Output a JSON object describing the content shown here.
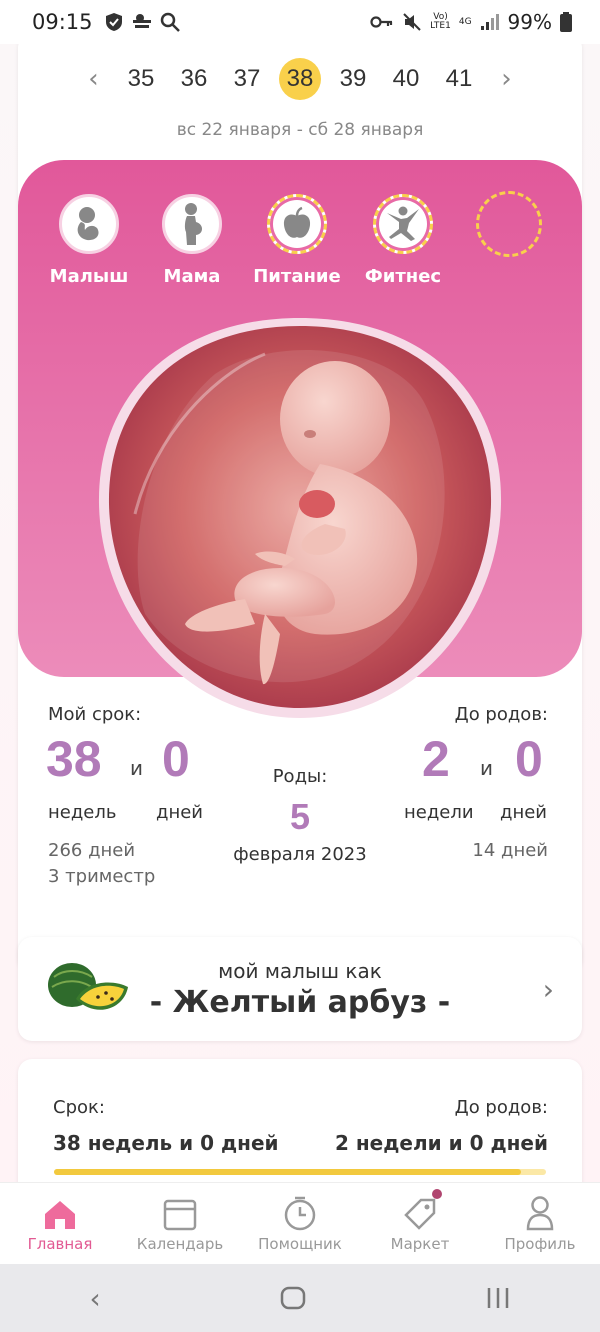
{
  "status_bar": {
    "time": "09:15",
    "network_top": "Vo)",
    "network_bottom": "LTE1",
    "net_type": "4G",
    "battery": "99%"
  },
  "weeks": {
    "items": [
      "35",
      "36",
      "37",
      "38",
      "39",
      "40",
      "41"
    ],
    "active": "38",
    "range": "вс 22 января - сб 28 января"
  },
  "tabs": [
    {
      "label": "Малыш",
      "icon": "baby-icon"
    },
    {
      "label": "Мама",
      "icon": "pregnant-woman-icon"
    },
    {
      "label": "Питание",
      "icon": "apple-icon"
    },
    {
      "label": "Фитнес",
      "icon": "yoga-icon"
    },
    {
      "label": "",
      "icon": "empty-slot"
    }
  ],
  "term": {
    "my_term_label": "Мой срок:",
    "weeks_value": "38",
    "and_1": "и",
    "days_value": "0",
    "weeks_unit": "недель",
    "days_unit": "дней",
    "total_days": "266 дней",
    "trimester": "3 триместр",
    "birth_label": "Роды:",
    "birth_day": "5",
    "birth_month_year": "февраля 2023",
    "to_birth_label": "До родов:",
    "left_weeks": "2",
    "and_2": "и",
    "left_days": "0",
    "left_weeks_unit": "недели",
    "left_days_unit": "дней",
    "left_total_days": "14 дней"
  },
  "fruit": {
    "caption": "мой малыш как",
    "name": "- Желтый арбуз -"
  },
  "progress": {
    "term_label": "Срок:",
    "term_value": "38 недель и 0 дней",
    "left_label": "До родов:",
    "left_value": "2 недели и 0 дней",
    "fraction": 0.95
  },
  "nav": [
    {
      "label": "Главная",
      "icon": "home-icon",
      "active": true
    },
    {
      "label": "Календарь",
      "icon": "calendar-icon"
    },
    {
      "label": "Помощник",
      "icon": "timer-icon"
    },
    {
      "label": "Маркет",
      "icon": "tag-icon"
    },
    {
      "label": "Профиль",
      "icon": "profile-icon"
    }
  ],
  "colors": {
    "accent_pink": "#e25a93",
    "value_purple": "#b17ab8",
    "highlight_yellow": "#f9d04b"
  }
}
